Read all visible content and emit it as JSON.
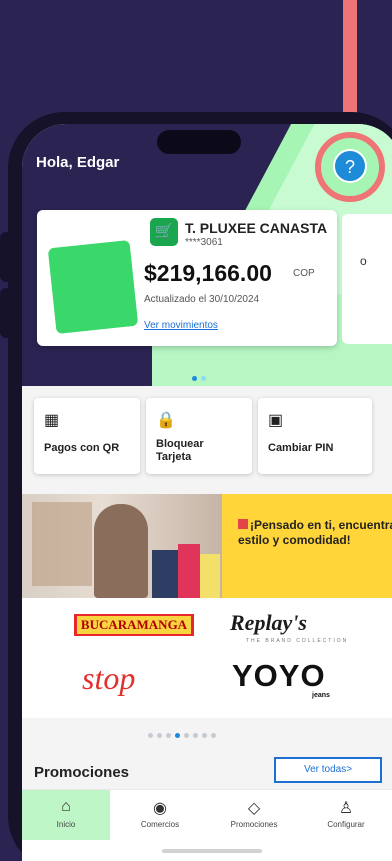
{
  "header": {
    "greeting": "Hola, Edgar",
    "help_icon": "question-icon"
  },
  "card": {
    "title": "T. PLUXEE CANASTA",
    "number": "****3061",
    "balance": "$219,166.00",
    "currency": "COP",
    "updated": "Actualizado el 30/10/2024",
    "movements_link": "Ver movimientos"
  },
  "card2": {
    "partial_text": "o"
  },
  "quick_actions": [
    {
      "label": "Pagos con QR",
      "icon": "qr-icon"
    },
    {
      "label": "Bloquear Tarjeta",
      "icon": "lock-icon"
    },
    {
      "label": "Cambiar PIN",
      "icon": "pin-icon"
    }
  ],
  "banner": {
    "text": "¡Pensado en ti, encuentra estilo y comodidad!"
  },
  "brands": {
    "bucaramanga": "BUCARAMANGA",
    "replays": "Replay's",
    "replays_sub": "THE BRAND COLLECTION",
    "stop": "stop",
    "yoyo": "YOYO",
    "yoyo_sub": "jeans"
  },
  "promotions": {
    "title": "Promociones",
    "see_all": "Ver todas>"
  },
  "tabs": [
    {
      "label": "Inicio",
      "icon": "home-icon"
    },
    {
      "label": "Comercios",
      "icon": "location-icon"
    },
    {
      "label": "Promociones",
      "icon": "tag-icon"
    },
    {
      "label": "Configurar",
      "icon": "user-icon"
    }
  ],
  "colors": {
    "accent_blue": "#1d6fd6",
    "brand_green": "#a6f5b4",
    "dark_bg": "#2b2452",
    "highlight": "#ef7475"
  }
}
